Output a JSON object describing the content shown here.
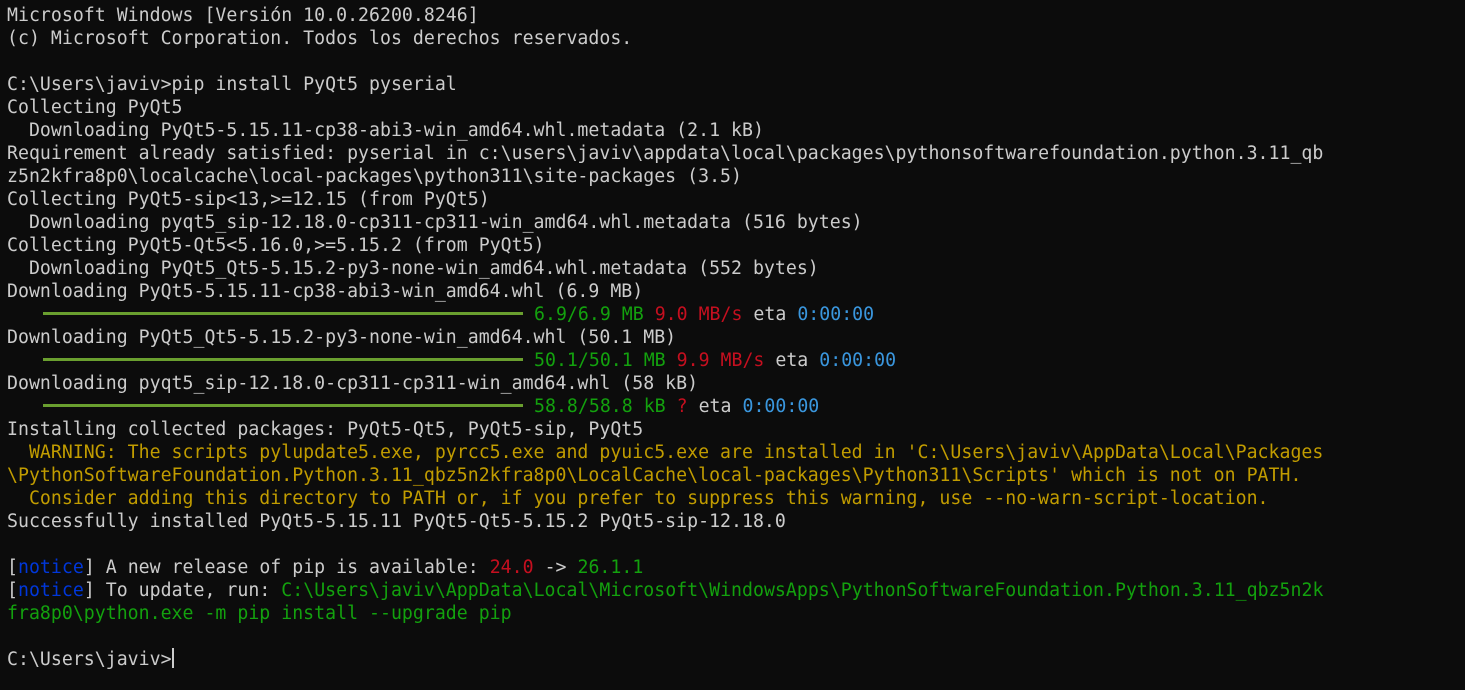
{
  "lines": [
    {
      "segs": [
        {
          "text": "Microsoft Windows [Versión 10.0.26200.8246]",
          "color": "default"
        }
      ]
    },
    {
      "segs": [
        {
          "text": "(c) Microsoft Corporation. Todos los derechos reservados.",
          "color": "default"
        }
      ]
    },
    {
      "segs": []
    },
    {
      "segs": [
        {
          "text": "C:\\Users\\javiv>pip install PyQt5 pyserial",
          "color": "default"
        }
      ]
    },
    {
      "segs": [
        {
          "text": "Collecting PyQt5",
          "color": "default"
        }
      ]
    },
    {
      "segs": [
        {
          "text": "  Downloading PyQt5-5.15.11-cp38-abi3-win_amd64.whl.metadata (2.1 kB)",
          "color": "default"
        }
      ]
    },
    {
      "segs": [
        {
          "text": "Requirement already satisfied: pyserial in c:\\users\\javiv\\appdata\\local\\packages\\pythonsoftwarefoundation.python.3.11_qb",
          "color": "default"
        }
      ]
    },
    {
      "segs": [
        {
          "text": "z5n2kfra8p0\\localcache\\local-packages\\python311\\site-packages (3.5)",
          "color": "default"
        }
      ]
    },
    {
      "segs": [
        {
          "text": "Collecting PyQt5-sip<13,>=12.15 (from PyQt5)",
          "color": "default"
        }
      ]
    },
    {
      "segs": [
        {
          "text": "  Downloading pyqt5_sip-12.18.0-cp311-cp311-win_amd64.whl.metadata (516 bytes)",
          "color": "default"
        }
      ]
    },
    {
      "segs": [
        {
          "text": "Collecting PyQt5-Qt5<5.16.0,>=5.15.2 (from PyQt5)",
          "color": "default"
        }
      ]
    },
    {
      "segs": [
        {
          "text": "  Downloading PyQt5_Qt5-5.15.2-py3-none-win_amd64.whl.metadata (552 bytes)",
          "color": "default"
        }
      ]
    },
    {
      "segs": [
        {
          "text": "Downloading PyQt5-5.15.11-cp38-abi3-win_amd64.whl (6.9 MB)",
          "color": "default"
        }
      ]
    },
    {
      "bar": true,
      "progress": 1.0,
      "segs": [
        {
          "text": "6.9/6.9 MB",
          "color": "green"
        },
        {
          "text": " ",
          "color": "default"
        },
        {
          "text": "9.0 MB/s",
          "color": "red"
        },
        {
          "text": " eta ",
          "color": "default"
        },
        {
          "text": "0:00:00",
          "color": "cyan"
        }
      ]
    },
    {
      "segs": [
        {
          "text": "Downloading PyQt5_Qt5-5.15.2-py3-none-win_amd64.whl (50.1 MB)",
          "color": "default"
        }
      ]
    },
    {
      "bar": true,
      "progress": 1.0,
      "segs": [
        {
          "text": "50.1/50.1 MB",
          "color": "green"
        },
        {
          "text": " ",
          "color": "default"
        },
        {
          "text": "9.9 MB/s",
          "color": "red"
        },
        {
          "text": " eta ",
          "color": "default"
        },
        {
          "text": "0:00:00",
          "color": "cyan"
        }
      ]
    },
    {
      "segs": [
        {
          "text": "Downloading pyqt5_sip-12.18.0-cp311-cp311-win_amd64.whl (58 kB)",
          "color": "default"
        }
      ]
    },
    {
      "bar": true,
      "progress": 1.0,
      "segs": [
        {
          "text": "58.8/58.8 kB",
          "color": "green"
        },
        {
          "text": " ",
          "color": "default"
        },
        {
          "text": "?",
          "color": "red"
        },
        {
          "text": " eta ",
          "color": "default"
        },
        {
          "text": "0:00:00",
          "color": "cyan"
        }
      ]
    },
    {
      "segs": [
        {
          "text": "Installing collected packages: PyQt5-Qt5, PyQt5-sip, PyQt5",
          "color": "default"
        }
      ]
    },
    {
      "segs": [
        {
          "text": "  WARNING: The scripts pylupdate5.exe, pyrcc5.exe and pyuic5.exe are installed in 'C:\\Users\\javiv\\AppData\\Local\\Packages",
          "color": "yellow"
        }
      ]
    },
    {
      "segs": [
        {
          "text": "\\PythonSoftwareFoundation.Python.3.11_qbz5n2kfra8p0\\LocalCache\\local-packages\\Python311\\Scripts' which is not on PATH.",
          "color": "yellow"
        }
      ]
    },
    {
      "segs": [
        {
          "text": "  Consider adding this directory to PATH or, if you prefer to suppress this warning, use --no-warn-script-location.",
          "color": "yellow"
        }
      ]
    },
    {
      "segs": [
        {
          "text": "Successfully installed PyQt5-5.15.11 PyQt5-Qt5-5.15.2 PyQt5-sip-12.18.0",
          "color": "default"
        }
      ]
    },
    {
      "segs": []
    },
    {
      "segs": [
        {
          "text": "[",
          "color": "default"
        },
        {
          "text": "notice",
          "color": "blue"
        },
        {
          "text": "] A new release of pip is available: ",
          "color": "default"
        },
        {
          "text": "24.0",
          "color": "red"
        },
        {
          "text": " -> ",
          "color": "default"
        },
        {
          "text": "26.1.1",
          "color": "green"
        }
      ]
    },
    {
      "segs": [
        {
          "text": "[",
          "color": "default"
        },
        {
          "text": "notice",
          "color": "blue"
        },
        {
          "text": "] To update, run: ",
          "color": "default"
        },
        {
          "text": "C:\\Users\\javiv\\AppData\\Local\\Microsoft\\WindowsApps\\PythonSoftwareFoundation.Python.3.11_qbz5n2k",
          "color": "green"
        }
      ]
    },
    {
      "segs": [
        {
          "text": "fra8p0\\python.exe -m pip install --upgrade pip",
          "color": "green"
        }
      ]
    },
    {
      "segs": []
    },
    {
      "prompt": true,
      "segs": [
        {
          "text": "C:\\Users\\javiv>",
          "color": "default"
        }
      ]
    }
  ],
  "colors": {
    "background": "#0c0c0c",
    "default": "#cccccc",
    "yellow": "#c19c00",
    "green": "#13a10e",
    "red": "#c50f1f",
    "cyan": "#3a96dd",
    "blue": "#0037da",
    "progress_bar": "#6a9f2f"
  }
}
